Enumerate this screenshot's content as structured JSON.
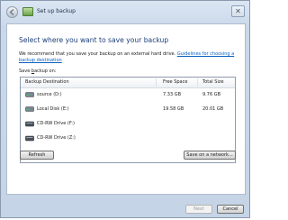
{
  "window": {
    "title": "Set up backup",
    "close_glyph": "✕"
  },
  "content": {
    "heading": "Select where you want to save your backup",
    "description": "We recommend that you save your backup on an external hard drive.",
    "guidelines_link": "Guidelines for choosing a backup destination",
    "save_label_prefix": "Save ",
    "save_label_underlined": "b",
    "save_label_suffix": "ackup on:"
  },
  "table": {
    "columns": {
      "destination": "Backup Destination",
      "free_space": "Free Space",
      "total_size": "Total Size"
    },
    "rows": [
      {
        "name": "source (D:)",
        "free": "7.33 GB",
        "total": "9.76 GB",
        "icon": "hard-drive-icon"
      },
      {
        "name": "Local Disk (E:)",
        "free": "19.58 GB",
        "total": "20.01 GB",
        "icon": "hard-drive-icon"
      },
      {
        "name": "CD-RW Drive (F:)",
        "free": "",
        "total": "",
        "icon": "cd-drive-icon"
      },
      {
        "name": "CD-RW Drive (Z:)",
        "free": "",
        "total": "",
        "icon": "cd-drive-icon"
      }
    ]
  },
  "buttons": {
    "refresh": "Refresh",
    "save_on_network": "Save on a network...",
    "next": "Next",
    "cancel": "Cancel"
  },
  "colors": {
    "heading": "#1a3e78",
    "link": "#0b61c0",
    "frame": "#c9d8ea"
  }
}
